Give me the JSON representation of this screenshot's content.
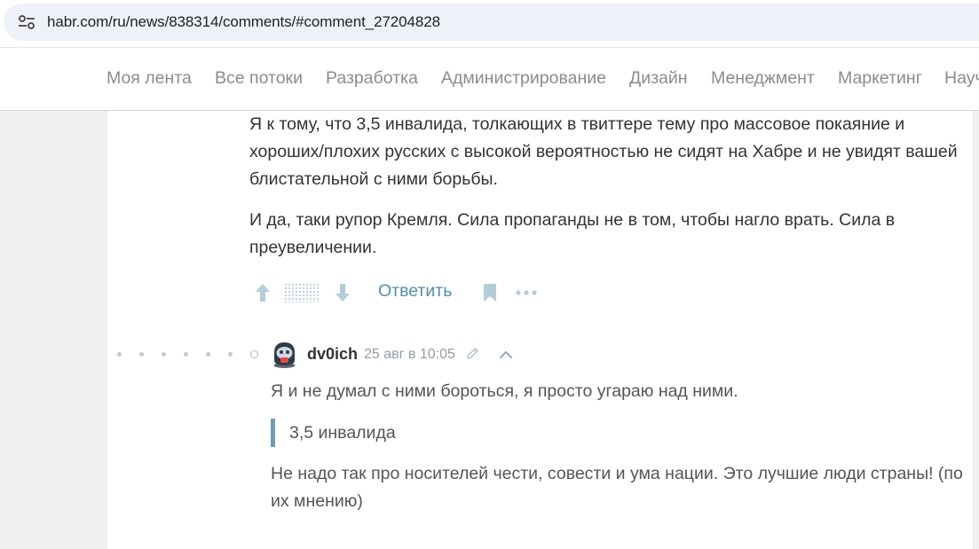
{
  "browser": {
    "url": "habr.com/ru/news/838314/comments/#comment_27204828",
    "site_info_icon": "tune-icon"
  },
  "nav": {
    "items": [
      {
        "label": "Моя лента"
      },
      {
        "label": "Все потоки"
      },
      {
        "label": "Разработка"
      },
      {
        "label": "Администрирование"
      },
      {
        "label": "Дизайн"
      },
      {
        "label": "Менеджмент"
      },
      {
        "label": "Маркетинг"
      },
      {
        "label": "Научпоп"
      }
    ]
  },
  "comment_parent": {
    "paragraphs": [
      "Я к тому, что 3,5 инвалида, толкающих в твиттере тему про массовое покаяние и хороших/плохих русских с высокой вероятностью не сидят на Хабре и не увидят вашей блистательной с ними борьбы.",
      "И да, таки рупор Кремля. Сила пропаганды не в том, чтобы нагло врать. Сила в преувеличении."
    ],
    "actions": {
      "reply_label": "Ответить",
      "icons": [
        "arrow-up-icon",
        "hidden-score",
        "arrow-down-icon",
        "bookmark-icon",
        "more-icon"
      ]
    }
  },
  "comment_reply": {
    "author": "dv0ich",
    "time": "25 авг в 10:05",
    "paragraph_1": "Я и не думал с ними бороться, я просто угараю над ними.",
    "quote": "3,5 инвалида",
    "paragraph_2": "Не надо так про носителей чести, совести и ума нации. Это лучшие люди страны! (по их мнению)"
  },
  "colors": {
    "accent": "#548eaa",
    "vote_icon": "#b3cdd8",
    "quote_border": "#6f9cb4",
    "nav_text": "#8c8c8c",
    "background": "#f0f0f0"
  }
}
